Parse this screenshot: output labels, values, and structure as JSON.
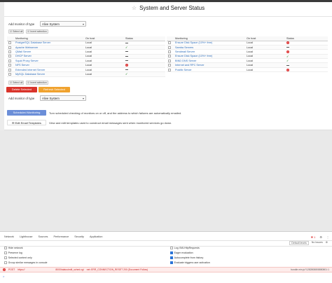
{
  "page": {
    "title": "System and Server Status"
  },
  "top_controls": {
    "add_label": "Add monitor of type",
    "add_value": "Alive System",
    "select_all": "Select all",
    "invert_selection": "Invert selection"
  },
  "table_headers": {
    "monitoring": "Monitoring",
    "on_host": "On host",
    "status": "Status"
  },
  "left_monitors": [
    {
      "name": "PostgreSQL Database Server",
      "host": "Local",
      "status": "dash"
    },
    {
      "name": "Apache Webserver",
      "host": "Local",
      "status": "ok"
    },
    {
      "name": "QMail Server",
      "host": "Local",
      "status": "dash"
    },
    {
      "name": "DHCP Server",
      "host": "Local",
      "status": "dash"
    },
    {
      "name": "Squid Proxy Server",
      "host": "Local",
      "status": "dash"
    },
    {
      "name": "NFS Server",
      "host": "Local",
      "status": "down"
    },
    {
      "name": "Extended Internet Server",
      "host": "Local",
      "status": "dash"
    },
    {
      "name": "MySQL Database Server",
      "host": "Local",
      "status": "ok"
    }
  ],
  "right_monitors": [
    {
      "name": "Ensure Disk Space (10%+ free)",
      "host": "Local",
      "status": "down"
    },
    {
      "name": "Samba Servers",
      "host": "Local",
      "status": "dash"
    },
    {
      "name": "Sendmail Server",
      "host": "Local",
      "status": "down"
    },
    {
      "name": "Ensure Disk Space (10%+ free)",
      "host": "Local",
      "status": "ok"
    },
    {
      "name": "BIND DNS Server",
      "host": "Local",
      "status": "ok"
    },
    {
      "name": "Internet and RPC Server",
      "host": "Local",
      "status": "dash"
    },
    {
      "name": "Postfix Server",
      "host": "Local",
      "status": "down"
    }
  ],
  "actions": {
    "delete_selected": "Delete Selected",
    "refresh_selected": "Refresh Selected",
    "scheduled_monitoring": "Scheduled Monitoring",
    "scheduled_desc": "Turn scheduled checking of monitors on or off, and the address to which failures are automatically emailed.",
    "edit_email_templates": "Edit Email Templates",
    "edit_desc": "View and edit templates used to construct email messages sent when monitored services go down."
  },
  "devtools": {
    "tabs": [
      "Network",
      "Lighthouse",
      "Sources",
      "Performance",
      "Security",
      "Application"
    ],
    "error_count": "1",
    "default_levels": "Default levels",
    "issues": "No Issues",
    "options_left": [
      {
        "label": "Hide network",
        "checked": false
      },
      {
        "label": "Preserve log",
        "checked": false
      },
      {
        "label": "Selected context only",
        "checked": false
      },
      {
        "label": "Group similar messages in console",
        "checked": false
      }
    ],
    "options_right": [
      {
        "label": "Log XMLHttpRequests",
        "checked": false
      },
      {
        "label": "Eager evaluation",
        "checked": true
      },
      {
        "label": "Autocomplete from history",
        "checked": true
      },
      {
        "label": "Evaluate triggers user activation",
        "checked": true
      }
    ],
    "error_line": {
      "method": "POST",
      "url": "https://",
      "path": "8000/status/edit_sched.cgi",
      "code": "net::ERR_CONNECTION_RESET 200 (Document Follow)",
      "source": "bundle.min.js?1282808808880801:1"
    },
    "prompt": ">"
  }
}
